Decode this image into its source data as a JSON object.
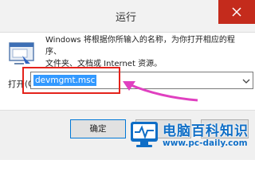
{
  "window": {
    "title": "运行"
  },
  "description": {
    "line1": "Windows 将根据你所输入的名称，为你打开相应的程序、",
    "line2": "文件夹、文档或 Internet 资源。"
  },
  "open_field": {
    "label": "打开(O):",
    "value": "devmgmt.msc"
  },
  "buttons": {
    "ok": "确定",
    "cancel": "",
    "browse": ""
  },
  "watermark": {
    "name": "电脑百科知识",
    "url": "www.pc-daily.com"
  },
  "colors": {
    "close_button": "#c42b1c",
    "selection": "#3399ff",
    "highlight_box": "#e4231b",
    "annotation_arrow": "#e040c0",
    "watermark_text": "#0f6ec6"
  }
}
